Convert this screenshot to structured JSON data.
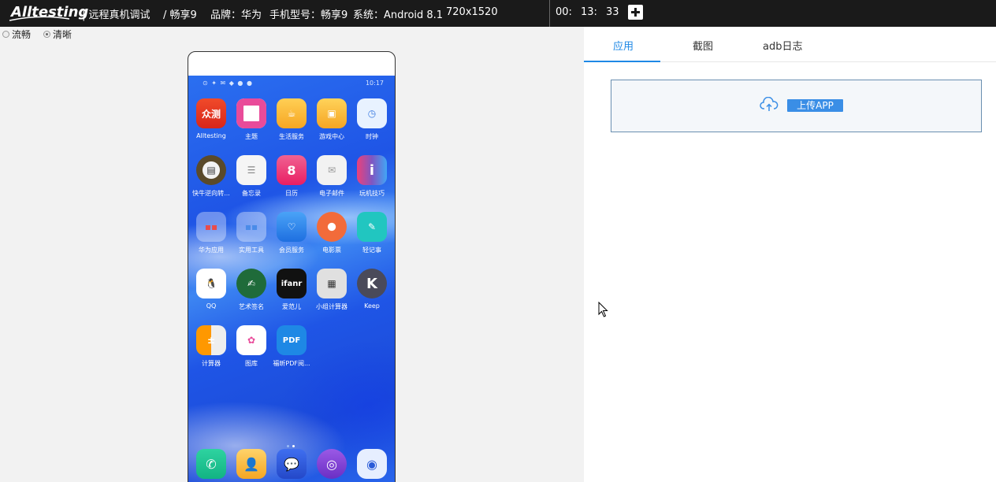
{
  "header": {
    "logo": "Alltesting",
    "page_title": "| 远程真机调试",
    "device_name": "/ 畅享9",
    "brand": "品牌：华为",
    "model": "手机型号：畅享9",
    "system": "系统：Android 8.1",
    "resolution": "720x1520",
    "timer": {
      "hours": "00:",
      "minutes": "13:",
      "seconds": "33"
    }
  },
  "quality": {
    "options": [
      {
        "label": "流畅",
        "selected": false
      },
      {
        "label": "清晰",
        "selected": true
      }
    ]
  },
  "phone": {
    "status_time": "10:17",
    "apps": [
      {
        "label": "Alltesting",
        "icon": "alltesting-icon",
        "text": "众测"
      },
      {
        "label": "主题",
        "icon": "theme-icon",
        "text": ""
      },
      {
        "label": "生活服务",
        "icon": "life-service-icon",
        "text": ""
      },
      {
        "label": "游戏中心",
        "icon": "game-center-icon",
        "text": ""
      },
      {
        "label": "时钟",
        "icon": "clock-icon",
        "text": ""
      },
      {
        "label": "快牛逆向转...",
        "icon": "unit-converter-icon",
        "text": ""
      },
      {
        "label": "备忘录",
        "icon": "memo-icon",
        "text": ""
      },
      {
        "label": "日历",
        "icon": "calendar-icon",
        "text": "8"
      },
      {
        "label": "电子邮件",
        "icon": "email-icon",
        "text": ""
      },
      {
        "label": "玩机技巧",
        "icon": "tips-icon",
        "text": "i"
      },
      {
        "label": "华为应用",
        "icon": "huawei-apps-folder-icon",
        "text": ""
      },
      {
        "label": "实用工具",
        "icon": "tools-folder-icon",
        "text": ""
      },
      {
        "label": "会员服务",
        "icon": "member-service-icon",
        "text": ""
      },
      {
        "label": "电影票",
        "icon": "movie-ticket-icon",
        "text": ""
      },
      {
        "label": "轻记事",
        "icon": "notes-icon",
        "text": ""
      },
      {
        "label": "QQ",
        "icon": "qq-icon",
        "text": ""
      },
      {
        "label": "艺术签名",
        "icon": "art-signature-icon",
        "text": ""
      },
      {
        "label": "爱范儿",
        "icon": "ifanr-icon",
        "text": "ifanr"
      },
      {
        "label": "小组计算器",
        "icon": "calculator-icon",
        "text": ""
      },
      {
        "label": "Keep",
        "icon": "keep-icon",
        "text": "K"
      },
      {
        "label": "计算器",
        "icon": "calculator2-icon",
        "text": ""
      },
      {
        "label": "图库",
        "icon": "gallery-icon",
        "text": ""
      },
      {
        "label": "福昕PDF阅...",
        "icon": "pdf-reader-icon",
        "text": "PDF"
      }
    ],
    "dock": [
      {
        "icon": "phone-icon"
      },
      {
        "icon": "contacts-icon"
      },
      {
        "icon": "messages-icon"
      },
      {
        "icon": "browser-icon"
      },
      {
        "icon": "camera-icon"
      }
    ]
  },
  "panel": {
    "tabs": [
      {
        "label": "应用",
        "active": true
      },
      {
        "label": "截图",
        "active": false
      },
      {
        "label": "adb日志",
        "active": false
      }
    ],
    "upload_label": "上传APP"
  },
  "colors": {
    "accent": "#1e88e5",
    "topbar": "#1a1a1a",
    "upload_button": "#3a8ee6"
  }
}
